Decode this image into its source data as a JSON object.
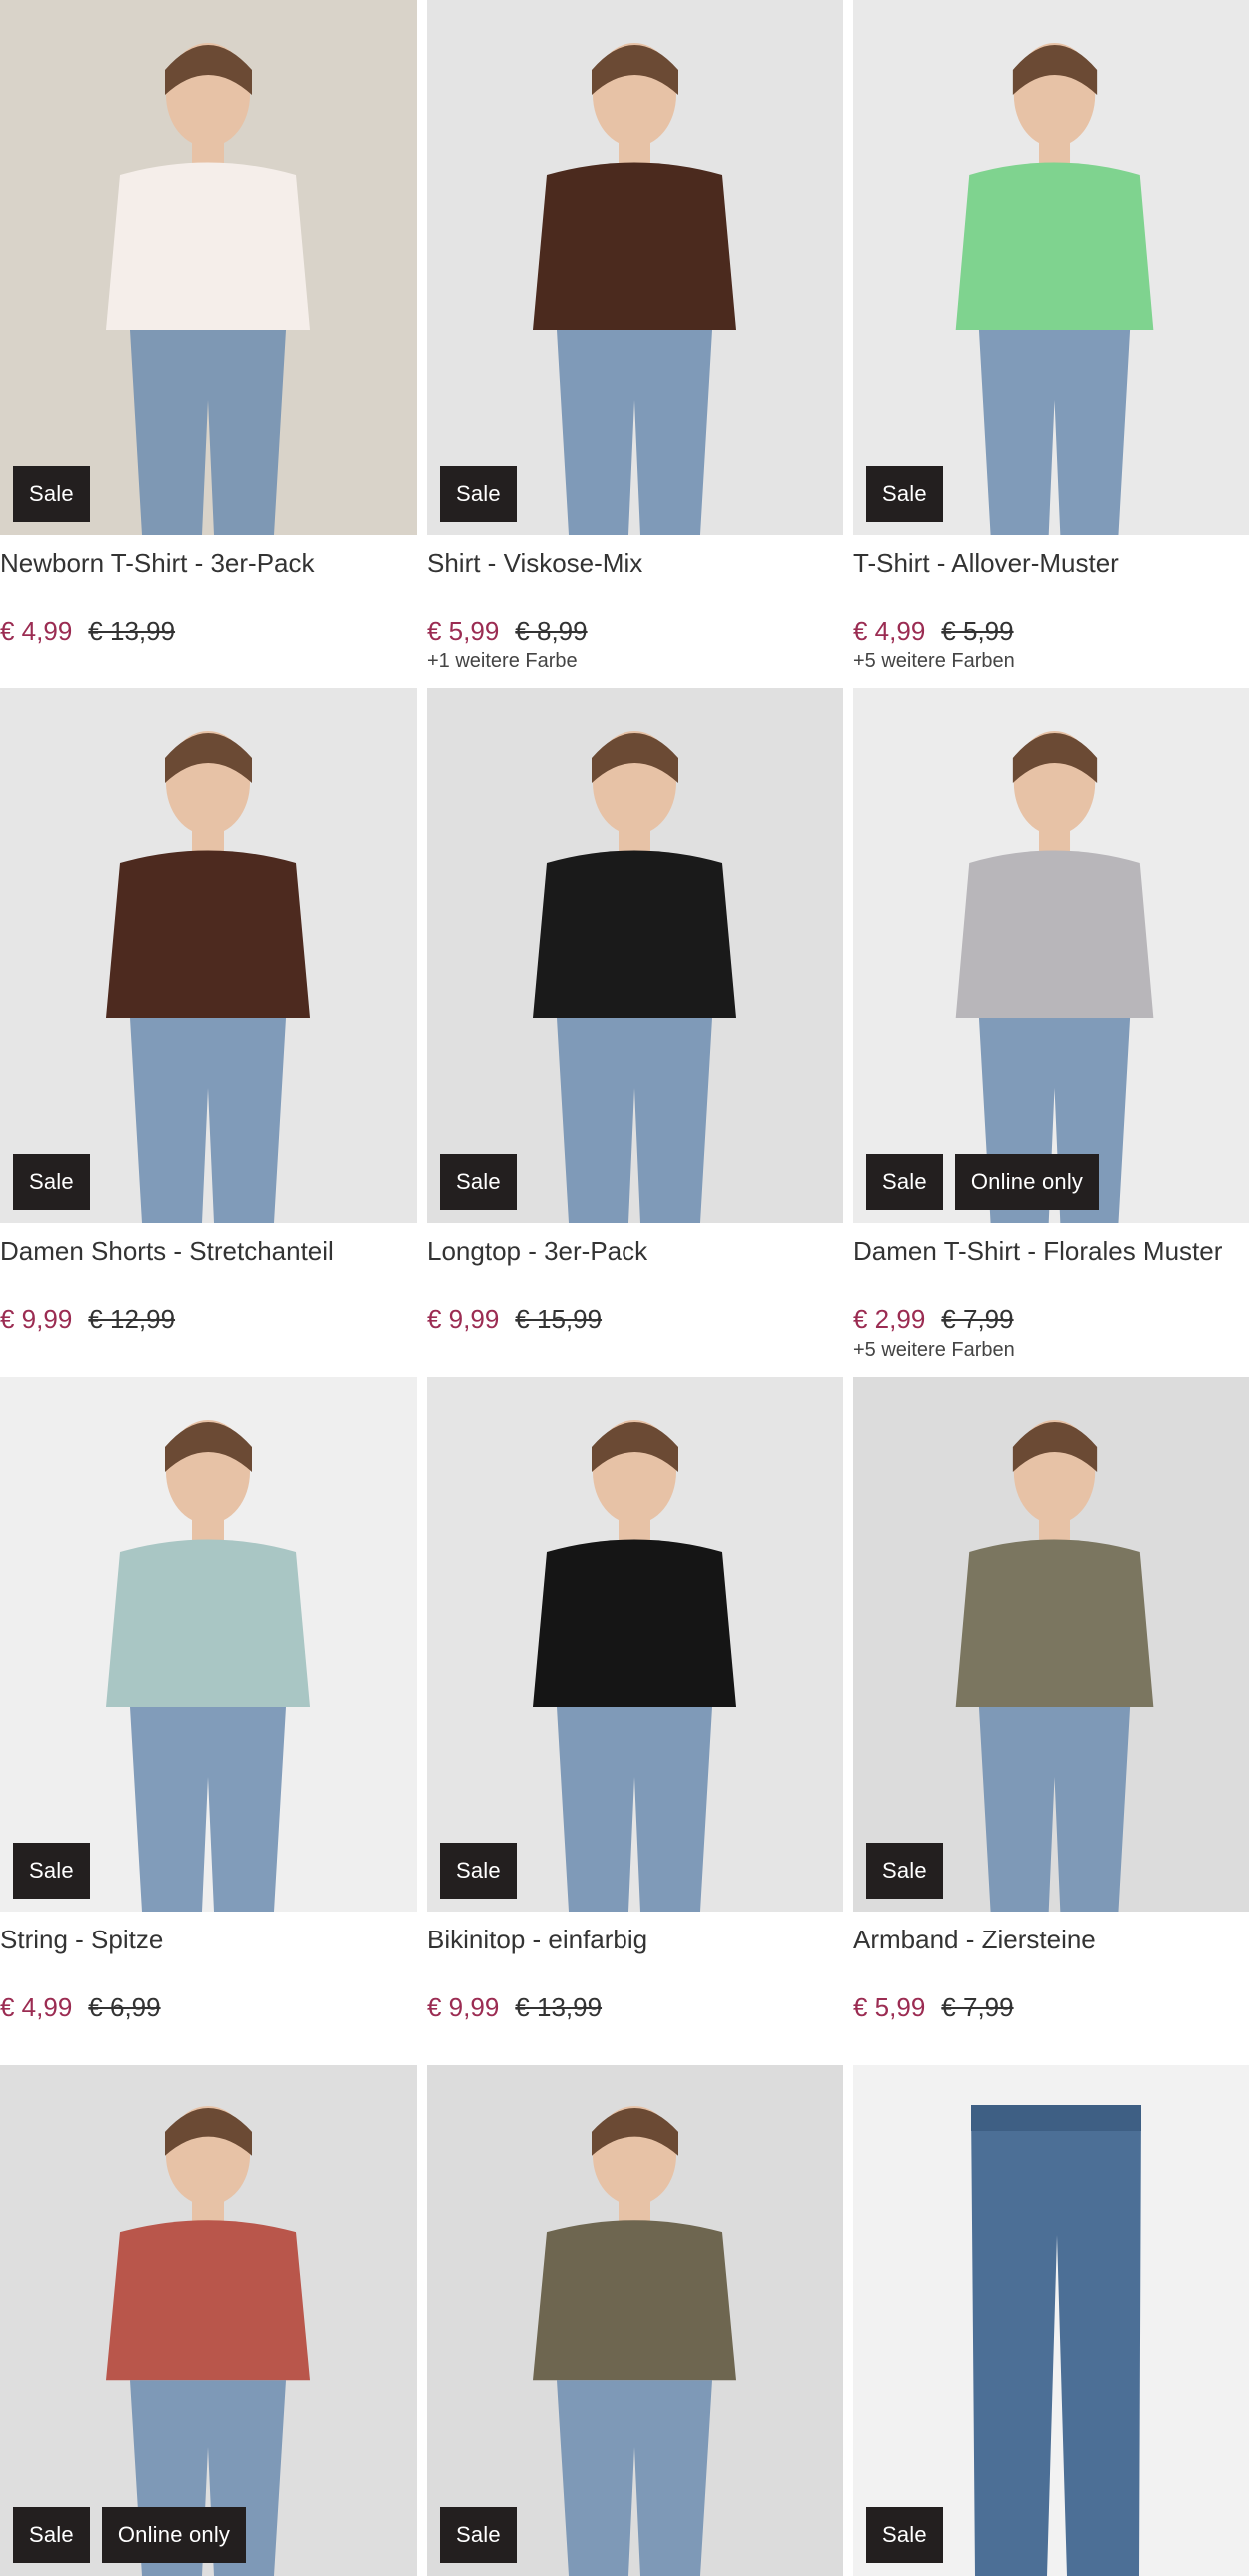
{
  "products": [
    {
      "name": "Newborn T-Shirt - 3er-Pack",
      "price": "€ 4,99",
      "old_price": "€ 13,99",
      "colors": "",
      "badges": [
        "Sale"
      ],
      "bg": "#d9d3c9",
      "shirt": "#f5eeea"
    },
    {
      "name": "Shirt - Viskose-Mix",
      "price": "€ 5,99",
      "old_price": "€ 8,99",
      "colors": "+1 weitere Farbe",
      "badges": [
        "Sale"
      ],
      "bg": "#e4e4e4",
      "shirt": "#4b2a1e"
    },
    {
      "name": "T-Shirt - Allover-Muster",
      "price": "€ 4,99",
      "old_price": "€ 5,99",
      "colors": "+5 weitere Farben",
      "badges": [
        "Sale"
      ],
      "bg": "#e9e9e9",
      "shirt": "#7fd38f"
    },
    {
      "name": "Damen Shorts - Stretchanteil",
      "price": "€ 9,99",
      "old_price": "€ 12,99",
      "colors": "",
      "badges": [
        "Sale"
      ],
      "bg": "#e6e6e6",
      "shirt": "#4d2a1f"
    },
    {
      "name": "Longtop - 3er-Pack",
      "price": "€ 9,99",
      "old_price": "€ 15,99",
      "colors": "",
      "badges": [
        "Sale"
      ],
      "bg": "#e0e0e0",
      "shirt": "#1a1a1a"
    },
    {
      "name": "Damen T-Shirt - Florales Muster",
      "price": "€ 2,99",
      "old_price": "€ 7,99",
      "colors": "+5 weitere Farben",
      "badges": [
        "Sale",
        "Online only"
      ],
      "bg": "#ececec",
      "shirt": "#b8b6ba"
    },
    {
      "name": "String - Spitze",
      "price": "€ 4,99",
      "old_price": "€ 6,99",
      "colors": "",
      "badges": [
        "Sale"
      ],
      "bg": "#efefef",
      "shirt": "#a9c6c4"
    },
    {
      "name": "Bikinitop - einfarbig",
      "price": "€ 9,99",
      "old_price": "€ 13,99",
      "colors": "",
      "badges": [
        "Sale"
      ],
      "bg": "#e5e5e5",
      "shirt": "#151515"
    },
    {
      "name": "Armband - Ziersteine",
      "price": "€ 5,99",
      "old_price": "€ 7,99",
      "colors": "",
      "badges": [
        "Sale"
      ],
      "bg": "#dcdcdc",
      "shirt": "#7b7660"
    },
    {
      "name": "",
      "price": "",
      "old_price": "",
      "colors": "",
      "badges": [
        "Sale",
        "Online only"
      ],
      "bg": "#dedede",
      "shirt": "#b9564b"
    },
    {
      "name": "",
      "price": "",
      "old_price": "",
      "colors": "",
      "badges": [
        "Sale"
      ],
      "bg": "#dcdcdc",
      "shirt": "#6e6650"
    },
    {
      "name": "",
      "price": "",
      "old_price": "",
      "colors": "",
      "badges": [
        "Sale"
      ],
      "bg": "#f2f2f2",
      "shirt": "#4c6f96"
    }
  ]
}
